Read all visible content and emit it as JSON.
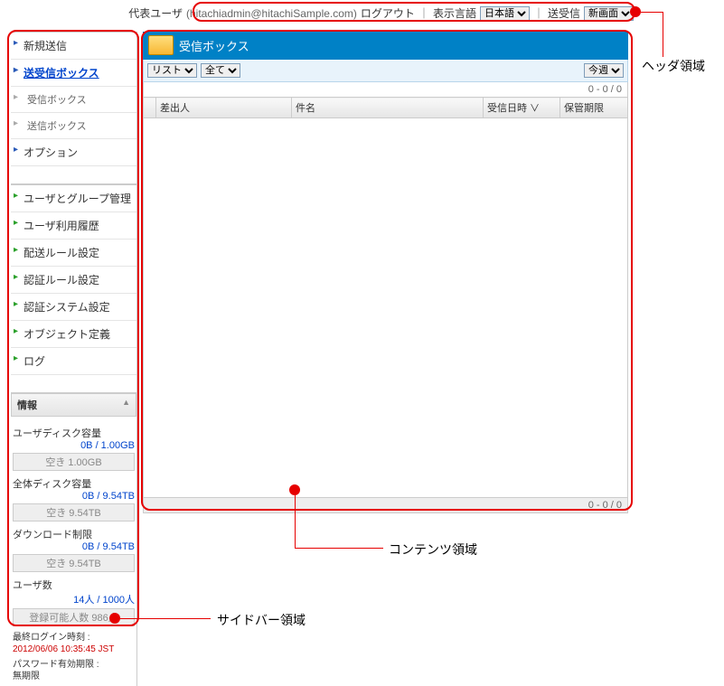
{
  "header": {
    "rep_user_label": "代表ユーザ",
    "user_email": "(hitachiadmin@hitachiSample.com)",
    "logout": "ログアウト",
    "lang_label": "表示言語",
    "lang_value": "日本語",
    "sendrecv_label": "送受信",
    "sendrecv_value": "新画面"
  },
  "sidebar": {
    "group1": [
      {
        "label": "新規送信",
        "style": "blue"
      },
      {
        "label": "送受信ボックス",
        "style": "blue",
        "active": true
      },
      {
        "label": "受信ボックス",
        "style": "gray",
        "sub": true
      },
      {
        "label": "送信ボックス",
        "style": "gray",
        "sub": true
      },
      {
        "label": "オプション",
        "style": "blue"
      }
    ],
    "group2": [
      {
        "label": "ユーザとグループ管理",
        "style": "green"
      },
      {
        "label": "ユーザ利用履歴",
        "style": "green"
      },
      {
        "label": "配送ルール設定",
        "style": "green"
      },
      {
        "label": "認証ルール設定",
        "style": "green"
      },
      {
        "label": "認証システム設定",
        "style": "green"
      },
      {
        "label": "オブジェクト定義",
        "style": "green"
      },
      {
        "label": "ログ",
        "style": "green"
      }
    ],
    "info": {
      "title": "情報",
      "disk_user_label": "ユーザディスク容量",
      "disk_user_value": "0B / 1.00GB",
      "disk_user_free": "空き 1.00GB",
      "disk_total_label": "全体ディスク容量",
      "disk_total_value": "0B / 9.54TB",
      "disk_total_free": "空き 9.54TB",
      "dl_label": "ダウンロード制限",
      "dl_value": "0B / 9.54TB",
      "dl_free": "空き 9.54TB",
      "users_label": "ユーザ数",
      "users_value": "14人 / 1000人",
      "users_free": "登録可能人数 986人",
      "last_login_label": "最終ログイン時刻 :",
      "last_login_value": "2012/06/06 10:35:45 JST",
      "pw_label": "パスワード有効期限 :",
      "pw_value": "無期限"
    }
  },
  "main": {
    "title": "受信ボックス",
    "view_mode": "リスト",
    "filter": "全て",
    "period": "今週",
    "pager": "0 - 0 / 0",
    "columns": {
      "sender": "差出人",
      "subject": "件名",
      "received": "受信日時 ∨",
      "retention": "保管期限"
    }
  },
  "annotations": {
    "header": "ヘッダ領域",
    "content": "コンテンツ領域",
    "sidebar": "サイドバー領域"
  }
}
